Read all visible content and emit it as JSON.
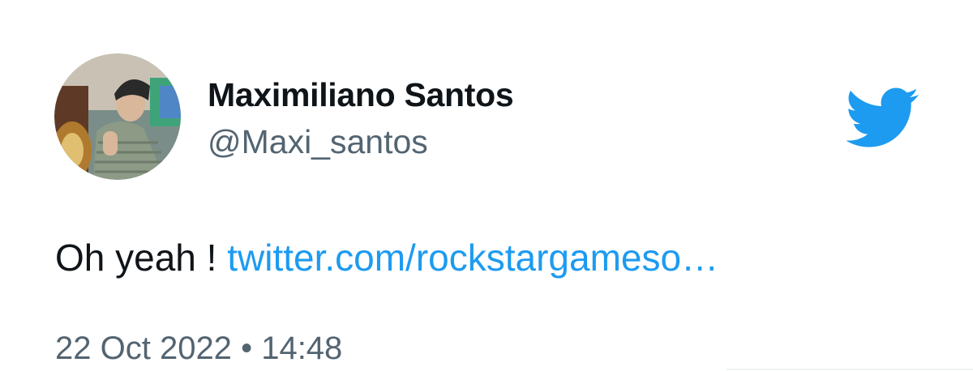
{
  "tweet": {
    "author": {
      "display_name": "Maximiliano Santos",
      "handle": "@Maxi_santos"
    },
    "text_prefix": "Oh yeah !",
    "link_text": "twitter.com/rockstargameso…",
    "date": "22 Oct 2022",
    "separator": "•",
    "time": "14:48"
  },
  "icons": {
    "brand": "twitter-bird-icon"
  },
  "colors": {
    "brand_blue": "#1d9bf0",
    "primary_text": "#0f1419",
    "secondary_text": "#536471"
  }
}
